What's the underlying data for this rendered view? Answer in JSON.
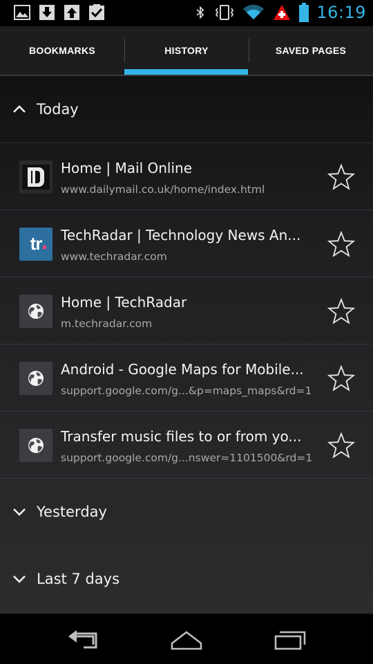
{
  "status_bar": {
    "time": "16:19",
    "left_icons": [
      "gallery-icon",
      "download-icon",
      "upload-icon",
      "clipboard-check-icon"
    ],
    "right_icons": [
      "bluetooth-icon",
      "vibrate-icon",
      "wifi-icon",
      "alert-icon",
      "battery-icon"
    ],
    "accent_color": "#33b5e5"
  },
  "tabs": [
    {
      "label": "BOOKMARKS",
      "selected": false
    },
    {
      "label": "HISTORY",
      "selected": true
    },
    {
      "label": "SAVED PAGES",
      "selected": false
    }
  ],
  "groups": {
    "today": {
      "label": "Today",
      "expanded": true
    },
    "yesterday": {
      "label": "Yesterday",
      "expanded": false
    },
    "last7": {
      "label": "Last 7 days",
      "expanded": false
    }
  },
  "history_items": [
    {
      "title": "Home | Mail Online",
      "url": "www.dailymail.co.uk/home/index.html",
      "icon": "dailymail-favicon"
    },
    {
      "title": "TechRadar | Technology News An...",
      "url": "www.techradar.com",
      "icon": "techradar-favicon",
      "icon_text": "tr"
    },
    {
      "title": "Home | TechRadar",
      "url": "m.techradar.com",
      "icon": "globe-icon"
    },
    {
      "title": "Android - Google Maps for Mobile...",
      "url": "support.google.com/g...&p=maps_maps&rd=1",
      "icon": "globe-icon"
    },
    {
      "title": "Transfer music files to or from yo...",
      "url": "support.google.com/g...nswer=1101500&rd=1",
      "icon": "globe-icon"
    }
  ],
  "nav": [
    "back-icon",
    "home-icon",
    "recent-apps-icon"
  ]
}
